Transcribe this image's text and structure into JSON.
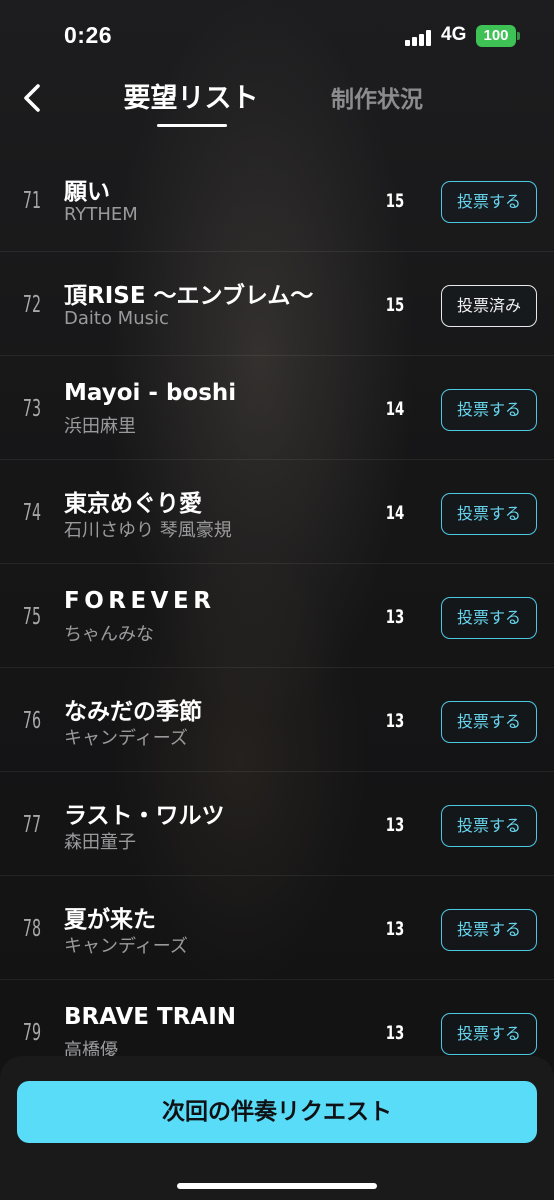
{
  "status_bar": {
    "time": "0:26",
    "network": "4G",
    "battery": "100",
    "battery_color": "#3ec255"
  },
  "nav": {
    "back_icon": "chevron-left-icon",
    "tabs": [
      {
        "label": "要望リスト",
        "active": true
      },
      {
        "label": "制作状況",
        "active": false
      }
    ]
  },
  "requests": [
    {
      "rank": "71",
      "title": "願い",
      "artist": "RYTHEM",
      "votes": "15",
      "button": "投票する",
      "voted": false
    },
    {
      "rank": "72",
      "title": "頂RISE 〜エンブレム〜",
      "artist": "Daito Music",
      "votes": "15",
      "button": "投票済み",
      "voted": true
    },
    {
      "rank": "73",
      "title": "Mayoi - boshi",
      "artist": "浜田麻里",
      "votes": "14",
      "button": "投票する",
      "voted": false
    },
    {
      "rank": "74",
      "title": "東京めぐり愛",
      "artist": "石川さゆり 琴風豪規",
      "votes": "14",
      "button": "投票する",
      "voted": false
    },
    {
      "rank": "75",
      "title": "FOREVER",
      "artist": "ちゃんみな",
      "votes": "13",
      "button": "投票する",
      "voted": false
    },
    {
      "rank": "76",
      "title": "なみだの季節",
      "artist": "キャンディーズ",
      "votes": "13",
      "button": "投票する",
      "voted": false
    },
    {
      "rank": "77",
      "title": "ラスト・ワルツ",
      "artist": "森田童子",
      "votes": "13",
      "button": "投票する",
      "voted": false
    },
    {
      "rank": "78",
      "title": "夏が来た",
      "artist": "キャンディーズ",
      "votes": "13",
      "button": "投票する",
      "voted": false
    },
    {
      "rank": "79",
      "title": "BRAVE TRAIN",
      "artist": "高橋優",
      "votes": "13",
      "button": "投票する",
      "voted": false
    }
  ],
  "footer": {
    "request_button": "次回の伴奏リクエスト",
    "accent_color": "#58dcf7"
  }
}
